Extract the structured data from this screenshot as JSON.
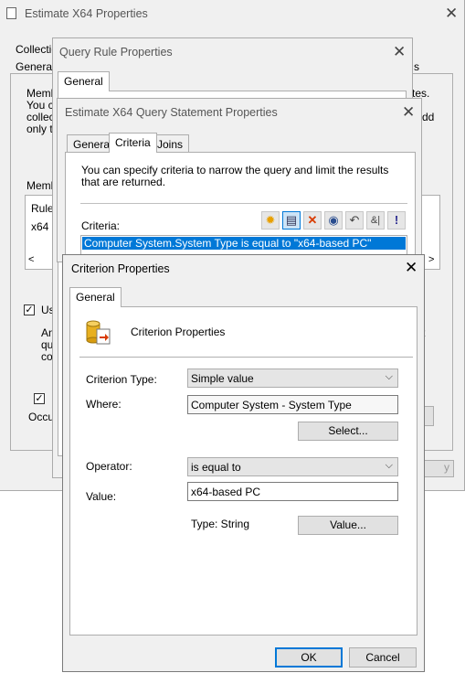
{
  "bg_window": {
    "title": "Estimate X64 Properties",
    "tabs": [
      "Collectio",
      "General"
    ],
    "left_texts": [
      "Memb",
      "You c",
      "collec",
      "only t"
    ],
    "right_texts": [
      "tes.",
      "dd"
    ],
    "members_label": "Memb",
    "members_header": "Rule",
    "members_row": "x64",
    "use_checkbox_label": "Us",
    "text_block": [
      "An",
      "qu",
      "co"
    ],
    "right_text_t": "t",
    "occu_label": "Occu",
    "apply_btn": "y"
  },
  "query_rule": {
    "title": "Query Rule Properties",
    "tab": "General",
    "right_tab": "s"
  },
  "statement": {
    "title": "Estimate X64 Query Statement Properties",
    "tabs": [
      "General",
      "Criteria",
      "Joins"
    ],
    "description": "You can specify criteria to narrow the query and limit the results that are returned.",
    "criteria_label": "Criteria:",
    "toolbar": [
      {
        "icon": "new-criterion-icon",
        "glyph": "✹"
      },
      {
        "icon": "properties-icon",
        "glyph": "▤"
      },
      {
        "icon": "delete-icon",
        "glyph": "✕"
      },
      {
        "icon": "group-icon",
        "glyph": "◉"
      },
      {
        "icon": "ungroup-icon",
        "glyph": "↶"
      },
      {
        "icon": "and-or-icon",
        "glyph": "&|"
      },
      {
        "icon": "not-icon",
        "glyph": "!"
      }
    ],
    "selected_criterion": "Computer System.System Type is equal to \"x64-based PC\""
  },
  "criterion": {
    "title": "Criterion Properties",
    "tab": "General",
    "header": "Criterion Properties",
    "criterion_type_label": "Criterion Type:",
    "criterion_type_value": "Simple value",
    "where_label": "Where:",
    "where_value": "Computer System - System Type",
    "select_button": "Select...",
    "operator_label": "Operator:",
    "operator_value": "is equal to",
    "value_label": "Value:",
    "value_value": "x64-based PC",
    "type_text": "Type: String",
    "value_button": "Value...",
    "ok_button": "OK",
    "cancel_button": "Cancel"
  },
  "colors": {
    "selection": "#0078d7",
    "delete_icon": "#d83b01",
    "new_icon": "#e8a000"
  }
}
